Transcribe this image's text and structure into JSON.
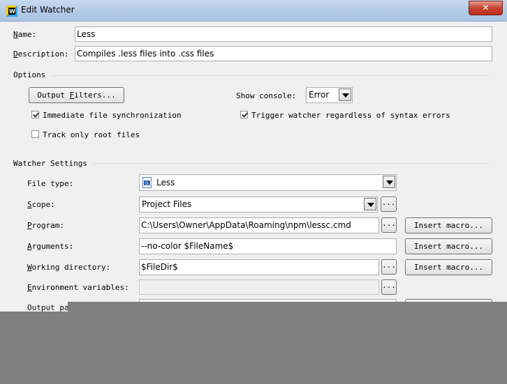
{
  "window": {
    "title": "Edit Watcher",
    "close_glyph": "✕"
  },
  "form": {
    "name_label_u": "N",
    "name_label_rest": "ame:",
    "name_value": "Less",
    "desc_label_u": "D",
    "desc_label_rest": "escription:",
    "desc_value": "Compiles .less files into .css files"
  },
  "options": {
    "group_label": "Options",
    "output_filters_u": "F",
    "output_filters_pre": "Output ",
    "output_filters_post": "ilters...",
    "show_console_label": "Show console:",
    "show_console_value": "Error",
    "immediate_sync_label": "Immediate file synchronization",
    "immediate_sync_checked": true,
    "track_root_label": "Track only root files",
    "track_root_checked": false,
    "trigger_label": "Trigger watcher regardless of syntax errors",
    "trigger_checked": true
  },
  "watcher": {
    "group_label": "Watcher Settings",
    "file_type_label": "File type:",
    "file_type_value": "Less",
    "scope_label_u": "S",
    "scope_label_rest": "cope:",
    "scope_value": "Project Files",
    "program_label_u": "P",
    "program_label_rest": "rogram:",
    "program_value": "C:\\Users\\Owner\\AppData\\Roaming\\npm\\lessc.cmd",
    "arguments_label_u": "A",
    "arguments_label_rest": "rguments:",
    "arguments_value": "--no-color $FileName$",
    "workdir_label_u": "W",
    "workdir_label_rest": "orking directory:",
    "workdir_value": "$FileDir$",
    "envvars_label_u": "E",
    "envvars_label_rest": "nvironment variables:",
    "envvars_value": "",
    "output_label_partial": "Output pa",
    "ellipsis": "...",
    "insert_macro_label": "Insert macro..."
  }
}
